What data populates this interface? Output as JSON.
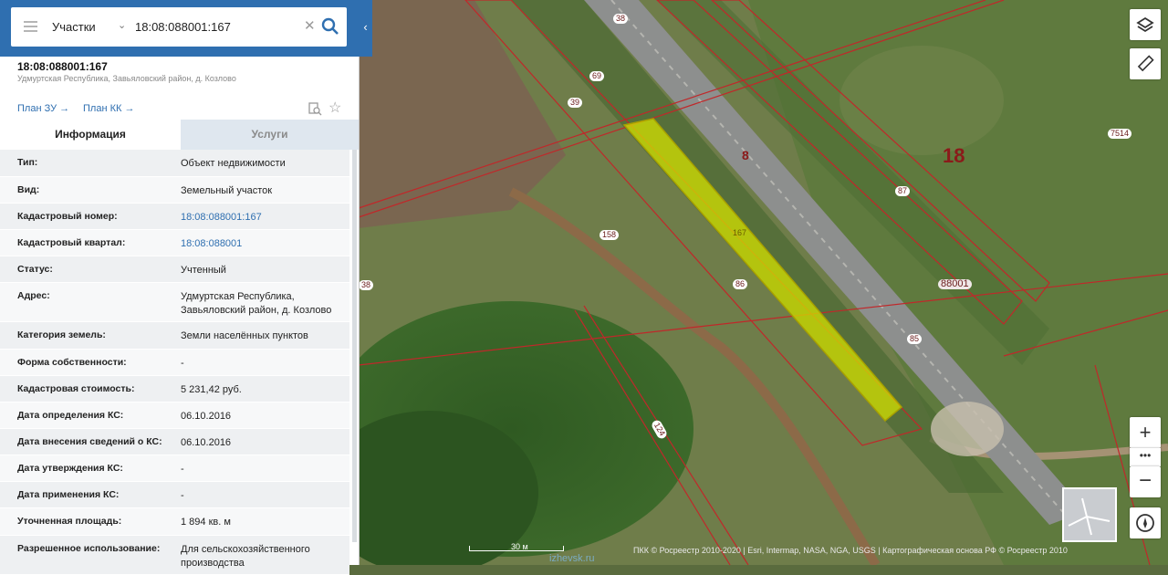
{
  "search": {
    "category": "Участки",
    "query": "18:08:088001:167"
  },
  "object": {
    "title": "18:08:088001:167",
    "address": "Удмуртская Республика, Завьяловский район, д. Козлово",
    "plan_zu": "План ЗУ",
    "plan_kk": "План КК"
  },
  "tabs": {
    "info": "Информация",
    "services": "Услуги"
  },
  "attributes": [
    {
      "label": "Тип:",
      "value": "Объект недвижимости",
      "link": false
    },
    {
      "label": "Вид:",
      "value": "Земельный участок",
      "link": false
    },
    {
      "label": "Кадастровый номер:",
      "value": "18:08:088001:167",
      "link": true
    },
    {
      "label": "Кадастровый квартал:",
      "value": "18:08:088001",
      "link": true
    },
    {
      "label": "Статус:",
      "value": "Учтенный",
      "link": false
    },
    {
      "label": "Адрес:",
      "value": "Удмуртская Республика, Завьяловский район, д. Козлово",
      "link": false
    },
    {
      "label": "Категория земель:",
      "value": "Земли населённых пунктов",
      "link": false
    },
    {
      "label": "Форма собственности:",
      "value": "-",
      "link": false
    },
    {
      "label": "Кадастровая стоимость:",
      "value": "5 231,42 руб.",
      "link": false
    },
    {
      "label": "Дата определения КС:",
      "value": "06.10.2016",
      "link": false
    },
    {
      "label": "Дата внесения сведений о КС:",
      "value": "06.10.2016",
      "link": false
    },
    {
      "label": "Дата утверждения КС:",
      "value": "-",
      "link": false
    },
    {
      "label": "Дата применения КС:",
      "value": "-",
      "link": false
    },
    {
      "label": "Уточненная площадь:",
      "value": "1 894 кв. м",
      "link": false
    },
    {
      "label": "Разрешенное использование:",
      "value": "Для сельскохозяйственного производства",
      "link": false
    }
  ],
  "map": {
    "labels": {
      "l38": "38",
      "l69": "69",
      "l39": "39",
      "l158": "158",
      "l86": "86",
      "l167": "167",
      "l85": "85",
      "l87": "87",
      "l7514": "7514",
      "l38b": "38",
      "l124": "124",
      "road": "8",
      "quarter": "18",
      "block": "88001"
    },
    "scale": "30 м",
    "attribution": "ПКК © Росреестр 2010-2020 | Esri, Intermap, NASA, NGA, USGS | Картографическая основа РФ © Росреестр 2010",
    "watermark": "izhevsk.ru"
  },
  "icons": {
    "menu": "hamburger-icon",
    "search": "search-icon",
    "clear": "close-icon",
    "layers": "layers-icon",
    "ruler": "ruler-icon",
    "compass": "compass-icon",
    "favorite": "star-icon",
    "document": "document-search-icon"
  },
  "colors": {
    "brand": "#2f6fb0",
    "parcel_fill": "#d4e000",
    "boundary": "#c0282a"
  }
}
